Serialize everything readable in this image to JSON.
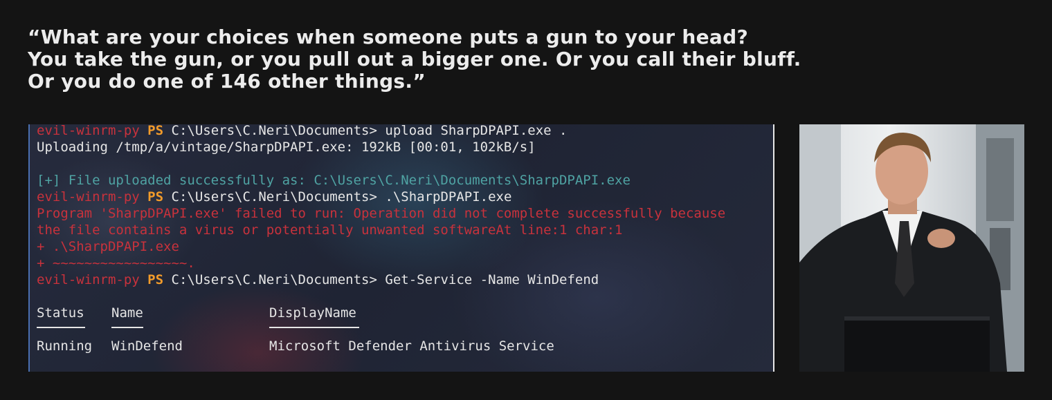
{
  "quote": {
    "line1": "“What are your choices when someone puts a gun to your head?",
    "line2": "You take the gun, or you pull out a bigger one. Or you call their bluff.",
    "line3": "Or you do one of 146 other things.”"
  },
  "terminal": {
    "prompt_name": "evil-winrm-py",
    "prompt_ps": "PS",
    "prompt_path": "C:\\Users\\C.Neri\\Documents>",
    "cmd1": " upload SharpDPAPI.exe .",
    "upload_progress": "Uploading /tmp/a/vintage/SharpDPAPI.exe: 192kB [00:01, 102kB/s]",
    "upload_success": "[+] File uploaded successfully as: C:\\Users\\C.Neri\\Documents\\SharpDPAPI.exe",
    "cmd2": " .\\SharpDPAPI.exe",
    "error1": "Program 'SharpDPAPI.exe' failed to run: Operation did not complete successfully because",
    "error2": "the file contains a virus or potentially unwanted softwareAt line:1 char:1",
    "error3": "+ .\\SharpDPAPI.exe",
    "error4": "+ ~~~~~~~~~~~~~~~~~.",
    "cmd3": " Get-Service -Name WinDefend",
    "table": {
      "headers": [
        "Status",
        "Name",
        "DisplayName"
      ],
      "row": [
        "Running",
        "WinDefend",
        "Microsoft Defender Antivirus Service"
      ]
    }
  },
  "colors": {
    "prompt_name": "#c8323c",
    "prompt_ps": "#f29b2a",
    "success": "#4fa3a3",
    "error": "#c8323c"
  }
}
